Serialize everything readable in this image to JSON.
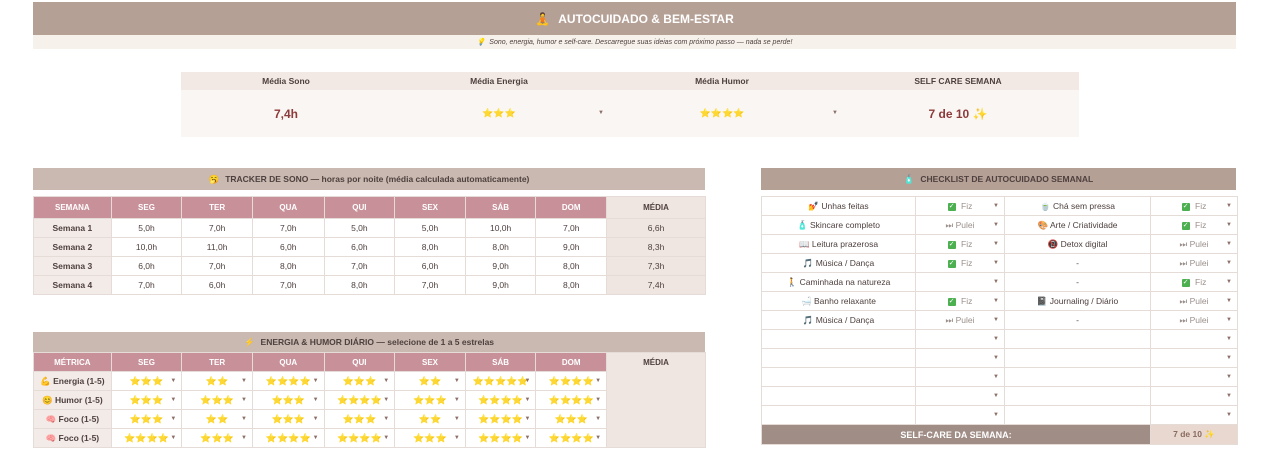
{
  "header": {
    "title": "AUTOCUIDADO & BEM-ESTAR",
    "icon": "🧘",
    "subtitle": "Sono, energia, humor e self-care. Descarregue suas ideias com próximo passo — nada se perde!",
    "subtitle_icon": "💡"
  },
  "summary": {
    "labels": [
      "Média Sono",
      "Média Energia",
      "Média Humor",
      "SELF CARE SEMANA"
    ],
    "sleep": "7,4h",
    "energy": "⭐⭐⭐",
    "mood": "⭐⭐⭐⭐",
    "selfcare": "7 de 10 ✨"
  },
  "sleep": {
    "icon": "🥱",
    "title": "TRACKER DE SONO — horas por noite (média calculada automaticamente)",
    "headers": [
      "SEMANA",
      "SEG",
      "TER",
      "QUA",
      "QUI",
      "SEX",
      "SÁB",
      "DOM",
      "MÉDIA"
    ],
    "rows": [
      [
        "Semana 1",
        "5,0h",
        "7,0h",
        "7,0h",
        "5,0h",
        "5,0h",
        "10,0h",
        "7,0h",
        "6,6h"
      ],
      [
        "Semana 2",
        "10,0h",
        "11,0h",
        "6,0h",
        "6,0h",
        "8,0h",
        "8,0h",
        "9,0h",
        "8,3h"
      ],
      [
        "Semana 3",
        "6,0h",
        "7,0h",
        "8,0h",
        "7,0h",
        "6,0h",
        "9,0h",
        "8,0h",
        "7,3h"
      ],
      [
        "Semana 4",
        "7,0h",
        "6,0h",
        "7,0h",
        "8,0h",
        "7,0h",
        "9,0h",
        "8,0h",
        "7,4h"
      ]
    ]
  },
  "energy": {
    "icon": "⚡",
    "title": "ENERGIA & HUMOR DIÁRIO — selecione de 1 a 5 estrelas",
    "headers": [
      "MÉTRICA",
      "SEG",
      "TER",
      "QUA",
      "QUI",
      "SEX",
      "SÁB",
      "DOM",
      "MÉDIA"
    ],
    "rows": [
      {
        "icon": "💪",
        "label": "Energia (1-5)",
        "values": [
          "⭐⭐⭐",
          "⭐⭐",
          "⭐⭐⭐⭐",
          "⭐⭐⭐",
          "⭐⭐",
          "⭐⭐⭐⭐⭐",
          "⭐⭐⭐⭐"
        ]
      },
      {
        "icon": "😊",
        "label": "Humor (1-5)",
        "values": [
          "⭐⭐⭐",
          "⭐⭐⭐",
          "⭐⭐⭐",
          "⭐⭐⭐⭐",
          "⭐⭐⭐",
          "⭐⭐⭐⭐",
          "⭐⭐⭐⭐"
        ]
      },
      {
        "icon": "🧠",
        "label": "Foco (1-5)",
        "values": [
          "⭐⭐⭐",
          "⭐⭐",
          "⭐⭐⭐",
          "⭐⭐⭐",
          "⭐⭐",
          "⭐⭐⭐⭐",
          "⭐⭐⭐"
        ]
      },
      {
        "icon": "🧠",
        "label": "Foco (1-5)",
        "values": [
          "⭐⭐⭐⭐",
          "⭐⭐⭐",
          "⭐⭐⭐⭐",
          "⭐⭐⭐⭐",
          "⭐⭐⭐",
          "⭐⭐⭐⭐",
          "⭐⭐⭐⭐"
        ]
      }
    ]
  },
  "checklist": {
    "icon": "🧴",
    "title": "CHECKLIST DE AUTOCUIDADO SEMANAL",
    "rows": [
      {
        "a_icon": "💅",
        "a": "Unhas feitas",
        "a_s": "Fiz",
        "b_icon": "🍵",
        "b": "Chá sem pressa",
        "b_s": "Fiz"
      },
      {
        "a_icon": "🧴",
        "a": "Skincare completo",
        "a_s": "Pulei",
        "b_icon": "🎨",
        "b": "Arte / Criatividade",
        "b_s": "Fiz"
      },
      {
        "a_icon": "📖",
        "a": "Leitura prazerosa",
        "a_s": "Fiz",
        "b_icon": "📵",
        "b": "Detox digital",
        "b_s": "Pulei"
      },
      {
        "a_icon": "🎵",
        "a": "Música / Dança",
        "a_s": "Fiz",
        "b_icon": "",
        "b": "-",
        "b_s": "Pulei"
      },
      {
        "a_icon": "🚶",
        "a": "Caminhada na natureza",
        "a_s": "",
        "b_icon": "",
        "b": "-",
        "b_s": "Fiz"
      },
      {
        "a_icon": "🛁",
        "a": "Banho relaxante",
        "a_s": "Fiz",
        "b_icon": "📓",
        "b": "Journaling / Diário",
        "b_s": "Pulei"
      },
      {
        "a_icon": "🎵",
        "a": "Música / Dança",
        "a_s": "Pulei",
        "b_icon": "",
        "b": "-",
        "b_s": "Pulei"
      },
      {
        "a_icon": "",
        "a": "",
        "a_s": "",
        "b_icon": "",
        "b": "",
        "b_s": ""
      },
      {
        "a_icon": "",
        "a": "",
        "a_s": "",
        "b_icon": "",
        "b": "",
        "b_s": ""
      },
      {
        "a_icon": "",
        "a": "",
        "a_s": "",
        "b_icon": "",
        "b": "",
        "b_s": ""
      },
      {
        "a_icon": "",
        "a": "",
        "a_s": "",
        "b_icon": "",
        "b": "",
        "b_s": ""
      },
      {
        "a_icon": "",
        "a": "",
        "a_s": "",
        "b_icon": "",
        "b": "",
        "b_s": ""
      }
    ],
    "footer_label": "SELF-CARE DA SEMANA:",
    "footer_value": "7 de 10 ✨"
  },
  "status_icons": {
    "Fiz": "✅",
    "Pulei": "⏭"
  }
}
